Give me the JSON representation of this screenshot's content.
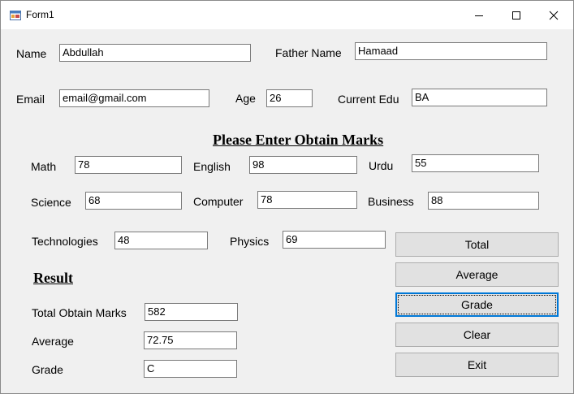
{
  "window": {
    "title": "Form1",
    "icon": "form-app-icon",
    "controls": [
      "minimize-icon",
      "maximize-icon",
      "close-icon"
    ]
  },
  "student": {
    "name_label": "Name",
    "name_value": "Abdullah",
    "father_label": "Father Name",
    "father_value": "Hamaad",
    "email_label": "Email",
    "email_value": "email@gmail.com",
    "age_label": "Age",
    "age_value": "26",
    "edu_label": "Current Edu",
    "edu_value": "BA"
  },
  "marks": {
    "heading": "Please Enter Obtain Marks",
    "math_label": "Math",
    "math_value": "78",
    "english_label": "English",
    "english_value": "98",
    "urdu_label": "Urdu",
    "urdu_value": "55",
    "science_label": "Science",
    "science_value": "68",
    "computer_label": "Computer",
    "computer_value": "78",
    "business_label": "Business",
    "business_value": "88",
    "tech_label": "Technologies",
    "tech_value": "48",
    "physics_label": "Physics",
    "physics_value": "69"
  },
  "result": {
    "heading": "Result",
    "total_label": "Total Obtain Marks",
    "total_value": "582",
    "average_label": "Average",
    "average_value": "72.75",
    "grade_label": "Grade",
    "grade_value": "C"
  },
  "buttons": {
    "total": "Total",
    "average": "Average",
    "grade": "Grade",
    "clear": "Clear",
    "exit": "Exit"
  },
  "colors": {
    "form_background": "#f0f0f0",
    "focus_border": "#0078d7",
    "button_face": "#e1e1e1"
  }
}
